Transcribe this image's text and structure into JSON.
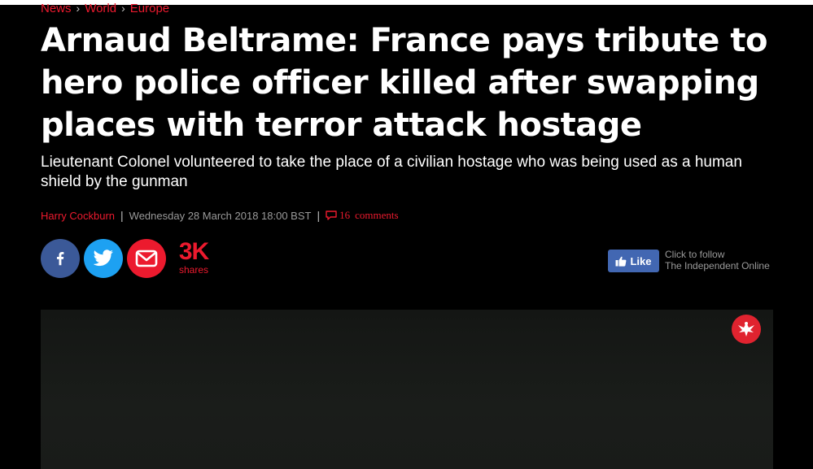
{
  "breadcrumb": {
    "items": [
      "News",
      "World",
      "Europe"
    ],
    "separator": "›"
  },
  "article": {
    "headline": "Arnaud Beltrame: France pays tribute to hero police officer killed after swapping places with terror attack hostage",
    "standfirst": "Lieutenant Colonel volunteered to take the place of a civilian hostage who was being used as a human shield by the gunman",
    "author": "Harry Cockburn",
    "date": "Wednesday 28 March 2018 18:00 BST",
    "comments_count": "16",
    "comments_label": "comments"
  },
  "share": {
    "count": "3K",
    "label": "shares",
    "icons": [
      "facebook-icon",
      "twitter-icon",
      "email-icon"
    ]
  },
  "facebook": {
    "like_label": "Like",
    "follow_line1": "Click to follow",
    "follow_line2": "The Independent Online"
  },
  "colors": {
    "accent": "#ec1a2e",
    "facebook": "#3b5998",
    "twitter": "#1da1f2",
    "fb_like": "#4267b2",
    "background": "#000000"
  }
}
